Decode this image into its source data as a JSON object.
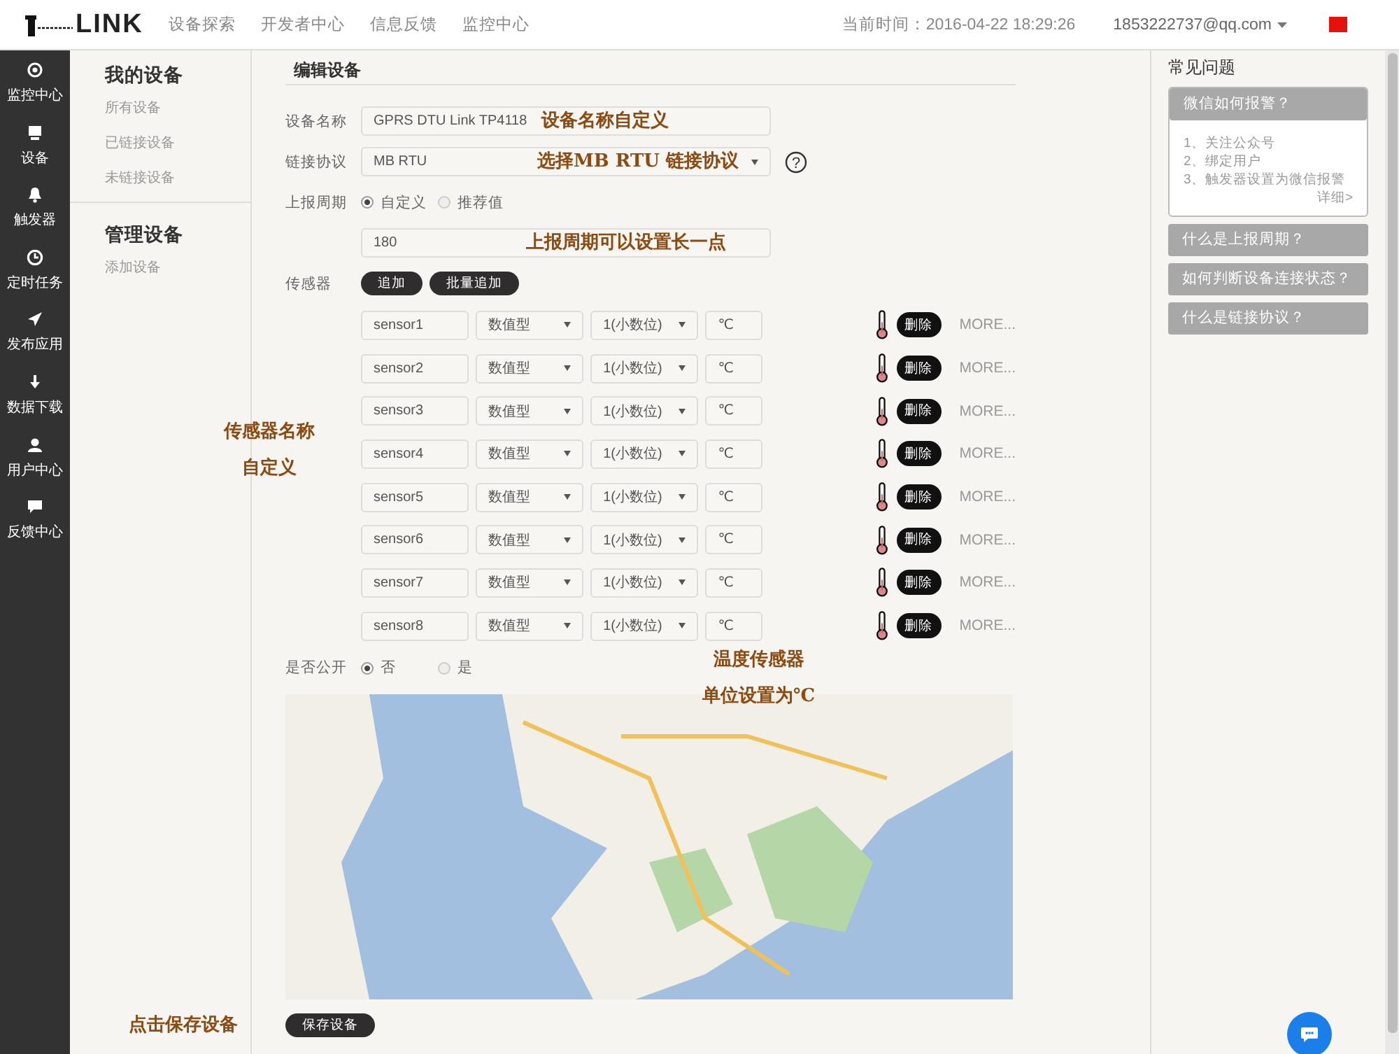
{
  "brand": {
    "name": "LINK"
  },
  "nav": [
    "设备探索",
    "开发者中心",
    "信息反馈",
    "监控中心"
  ],
  "clock": "当前时间：2016-04-22 18:29:26",
  "user": {
    "email": "1853222737@qq.com"
  },
  "sidebar": [
    {
      "label": "监控中心",
      "kind": "target"
    },
    {
      "label": "设备",
      "kind": "monitor"
    },
    {
      "label": "触发器",
      "kind": "bell"
    },
    {
      "label": "定时任务",
      "kind": "clock"
    },
    {
      "label": "发布应用",
      "kind": "plane"
    },
    {
      "label": "数据下载",
      "kind": "download"
    },
    {
      "label": "用户中心",
      "kind": "user"
    },
    {
      "label": "反馈中心",
      "kind": "chat"
    }
  ],
  "submenu": [
    {
      "title": "我的设备",
      "items": [
        "所有设备",
        "已链接设备",
        "未链接设备"
      ]
    },
    {
      "title": "管理设备",
      "items": [
        "添加设备"
      ]
    }
  ],
  "form": {
    "title": "编辑设备",
    "device_name": {
      "label": "设备名称",
      "value": "GPRS DTU Link TP4118"
    },
    "protocol": {
      "label": "链接协议",
      "value": "MB RTU",
      "help": "?"
    },
    "period": {
      "label": "上报周期",
      "options": [
        {
          "label": "自定义",
          "selected": true
        },
        {
          "label": "推荐值",
          "selected": false
        }
      ],
      "value": "180"
    },
    "sensors": {
      "label": "传感器",
      "buttons": [
        "追加",
        "批量追加"
      ],
      "rows": [
        {
          "name": "sensor1",
          "type": "数值型",
          "decimals": "1(小数位)",
          "unit": "℃",
          "delete": "删除",
          "more": "MORE..."
        },
        {
          "name": "sensor2",
          "type": "数值型",
          "decimals": "1(小数位)",
          "unit": "℃",
          "delete": "删除",
          "more": "MORE..."
        },
        {
          "name": "sensor3",
          "type": "数值型",
          "decimals": "1(小数位)",
          "unit": "℃",
          "delete": "删除",
          "more": "MORE..."
        },
        {
          "name": "sensor4",
          "type": "数值型",
          "decimals": "1(小数位)",
          "unit": "℃",
          "delete": "删除",
          "more": "MORE..."
        },
        {
          "name": "sensor5",
          "type": "数值型",
          "decimals": "1(小数位)",
          "unit": "℃",
          "delete": "删除",
          "more": "MORE..."
        },
        {
          "name": "sensor6",
          "type": "数值型",
          "decimals": "1(小数位)",
          "unit": "℃",
          "delete": "删除",
          "more": "MORE..."
        },
        {
          "name": "sensor7",
          "type": "数值型",
          "decimals": "1(小数位)",
          "unit": "℃",
          "delete": "删除",
          "more": "MORE..."
        },
        {
          "name": "sensor8",
          "type": "数值型",
          "decimals": "1(小数位)",
          "unit": "℃",
          "delete": "删除",
          "more": "MORE..."
        }
      ]
    },
    "public": {
      "label": "是否公开",
      "options": [
        {
          "label": "否",
          "selected": true
        },
        {
          "label": "是",
          "selected": false
        }
      ]
    },
    "save": "保存设备"
  },
  "faq": {
    "title": "常见问题",
    "items": [
      {
        "question": "微信如何报警？",
        "expanded": true,
        "answer": [
          "1、关注公众号",
          "2、绑定用户",
          "3、触发器设置为微信报警"
        ],
        "link": "详细>"
      },
      {
        "question": "什么是上报周期？",
        "expanded": false
      },
      {
        "question": "如何判断设备连接状态？",
        "expanded": false
      },
      {
        "question": "什么是链接协议？",
        "expanded": false
      }
    ]
  },
  "annotations": [
    {
      "lines": [
        "设备名称自定义"
      ]
    },
    {
      "lines": [
        "选择MB RTU 链接协议"
      ]
    },
    {
      "lines": [
        "上报周期可以设置长一点"
      ]
    },
    {
      "lines": [
        "传感器名称",
        "自定义"
      ]
    },
    {
      "lines": [
        "温度传感器",
        "单位设置为℃"
      ]
    },
    {
      "lines": [
        "点击保存设备"
      ]
    }
  ]
}
